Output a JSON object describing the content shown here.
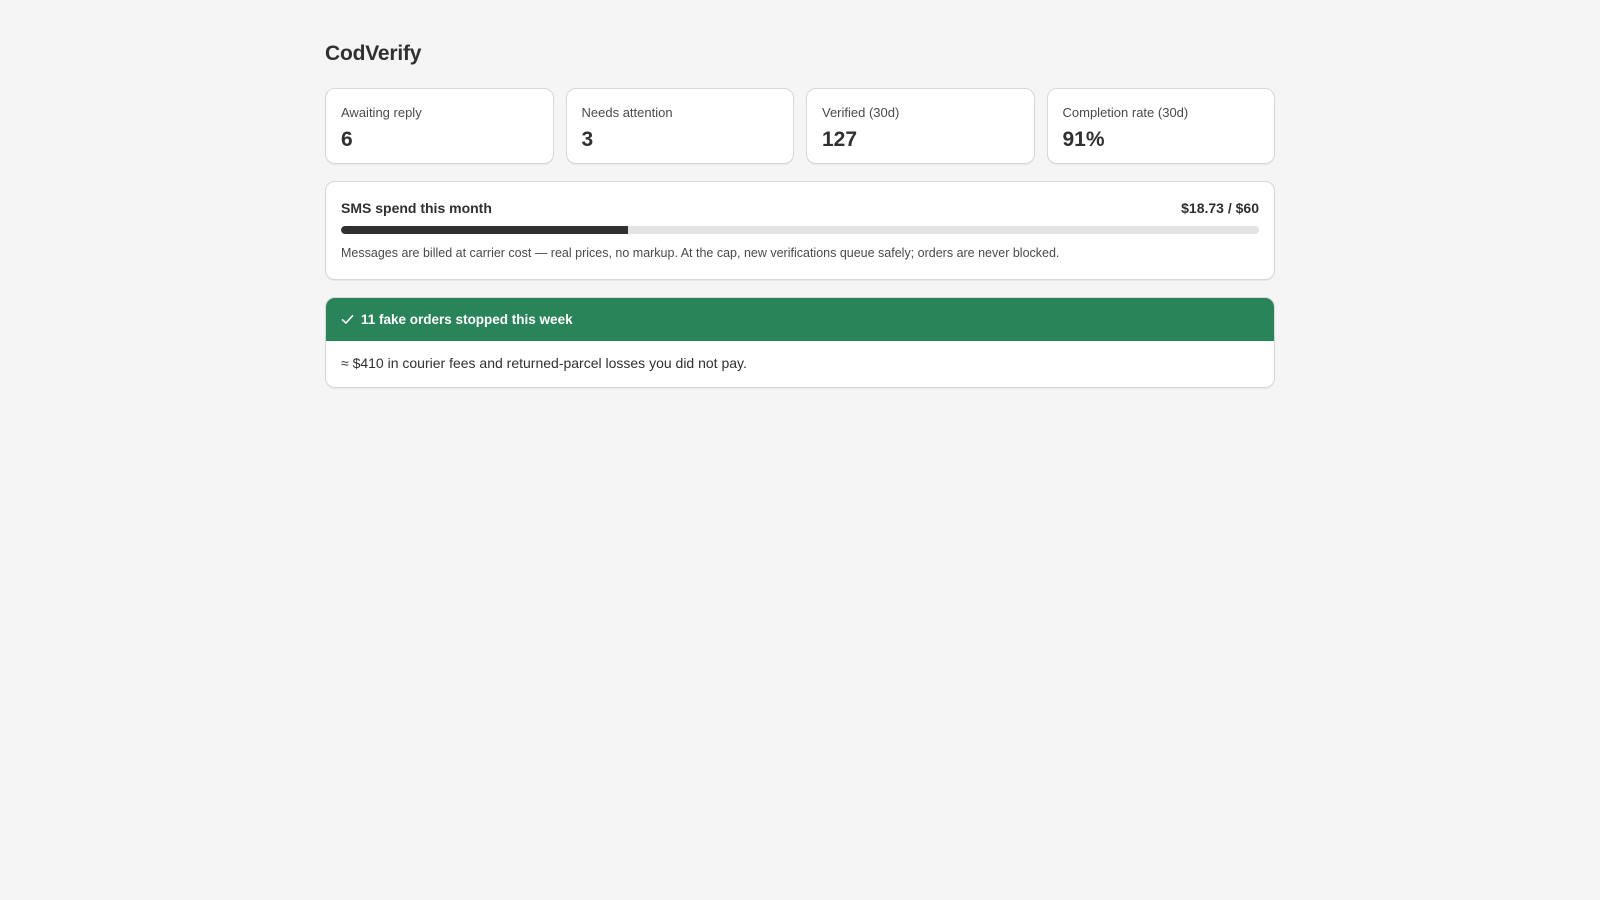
{
  "app": {
    "title": "CodVerify"
  },
  "stats": [
    {
      "label": "Awaiting reply",
      "value": "6"
    },
    {
      "label": "Needs attention",
      "value": "3"
    },
    {
      "label": "Verified (30d)",
      "value": "127"
    },
    {
      "label": "Completion rate (30d)",
      "value": "91%"
    }
  ],
  "sms_spend": {
    "title": "SMS spend this month",
    "amount": "$18.73 / $60",
    "spent": 18.73,
    "cap": 60,
    "note": "Messages are billed at carrier cost — real prices, no markup. At the cap, new verifications queue safely; orders are never blocked.",
    "bar_color": "#303030"
  },
  "impact": {
    "icon": "checkmark-icon",
    "title": "11 fake orders stopped this week",
    "detail": "≈ $410 in courier fees and returned-parcel losses you did not pay.",
    "accent_color": "#29845a"
  }
}
